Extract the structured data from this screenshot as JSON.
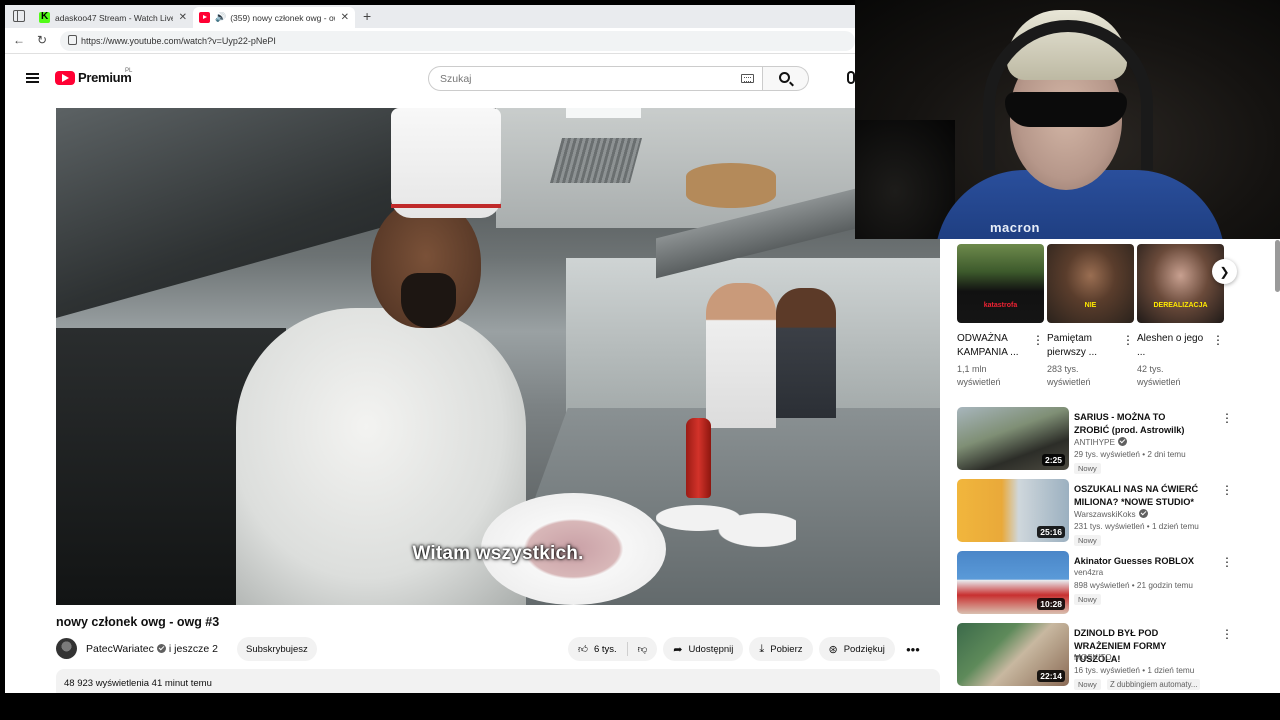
{
  "browser": {
    "tabs": [
      {
        "title": "adaskoo47 Stream - Watch Live o",
        "favicon": "kick-icon",
        "active": false
      },
      {
        "title": "(359) nowy członek owg - ow",
        "favicon": "youtube-icon",
        "active": true
      }
    ],
    "url": "https://www.youtube.com/watch?v=Uyp22-pNePI"
  },
  "youtube": {
    "brand": "Premium",
    "country": "PL",
    "search_placeholder": "Szukaj"
  },
  "video": {
    "subtitle": "Witam wszystkich.",
    "title": "nowy członek owg - owg #3",
    "channel": "PatecWariatec",
    "coauthors": "i jeszcze 2",
    "subscribe_label": "Subskrybujesz",
    "likes": "6 tys.",
    "share_label": "Udostępnij",
    "download_label": "Pobierz",
    "thanks_label": "Podziękuj",
    "description_meta": "48 923 wyświetlenia  41 minut temu"
  },
  "shorts": [
    {
      "title": "ODWAŻNA KAMPANIA ...",
      "views": "1,1 mln wyświetleń",
      "overlay": "katastrofa"
    },
    {
      "title": "Pamiętam pierwszy ...",
      "views": "283 tys. wyświetleń",
      "overlay": "NIE"
    },
    {
      "title": "Aleshen o jego ...",
      "views": "42 tys. wyświetleń",
      "overlay": "DEREALIZACJA"
    }
  ],
  "recommendations": [
    {
      "title": "SARIUS - MOŻNA TO ZROBIĆ (prod. Astrowilk)",
      "channel": "ANTIHYPE",
      "verified": true,
      "meta": "29 tys. wyświetleń • 2 dni temu",
      "badge": "Nowy",
      "duration": "2:25"
    },
    {
      "title": "OSZUKALI NAS NA ĆWIERĆ MILIONA? *NOWE STUDIO*",
      "channel": "WarszawskiKoks",
      "verified": true,
      "meta": "231 tys. wyświetleń • 1 dzień temu",
      "badge": "Nowy",
      "duration": "25:16"
    },
    {
      "title": "Akinator Guesses ROBLOX",
      "channel": "ven4zra",
      "verified": false,
      "meta": "898 wyświetleń • 21 godzin temu",
      "badge": "Nowy",
      "duration": "10:28"
    },
    {
      "title": "DZINOLD BYŁ POD WRAŻENIEM FORMY TUSZOLA!",
      "channel": "MOSKITO",
      "verified": false,
      "meta": "16 tys. wyświetleń • 1 dzień temu",
      "badge": "Nowy",
      "duration": "22:14",
      "extra": "Z dubbingiem automaty..."
    }
  ],
  "webcam": {
    "shirt_brand": "macron"
  },
  "colors": {
    "youtube_red": "#ff0033",
    "kick_green": "#53fc18"
  }
}
